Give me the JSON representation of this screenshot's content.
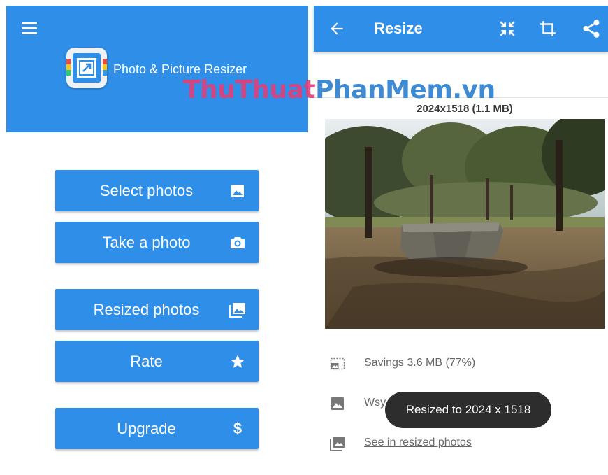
{
  "left": {
    "app_title": "Photo & Picture Resizer",
    "buttons": [
      {
        "label": "Select photos",
        "icon": "image-icon"
      },
      {
        "label": "Take a photo",
        "icon": "camera-icon"
      },
      {
        "label": "Resized photos",
        "icon": "photo-library-icon"
      },
      {
        "label": "Rate",
        "icon": "star-icon"
      },
      {
        "label": "Upgrade",
        "icon": "dollar-icon"
      }
    ]
  },
  "right": {
    "title": "Resize",
    "icons": [
      "back-arrow-icon",
      "compress-icon",
      "crop-icon",
      "share-icon"
    ],
    "dimensions": "2024x1518 (1.1 MB)",
    "savings": "Savings 3.6 MB (77%)",
    "filename_visible": "Wsy",
    "see_resized": "See in resized photos",
    "toast": "Resized to 2024 x 1518"
  },
  "watermark": {
    "part1": "ThuThuat",
    "part2": "PhanMem.vn"
  },
  "colors": {
    "primary": "#2e8ee8",
    "toast_bg": "#2d2d2d",
    "text_gray": "#666666"
  }
}
